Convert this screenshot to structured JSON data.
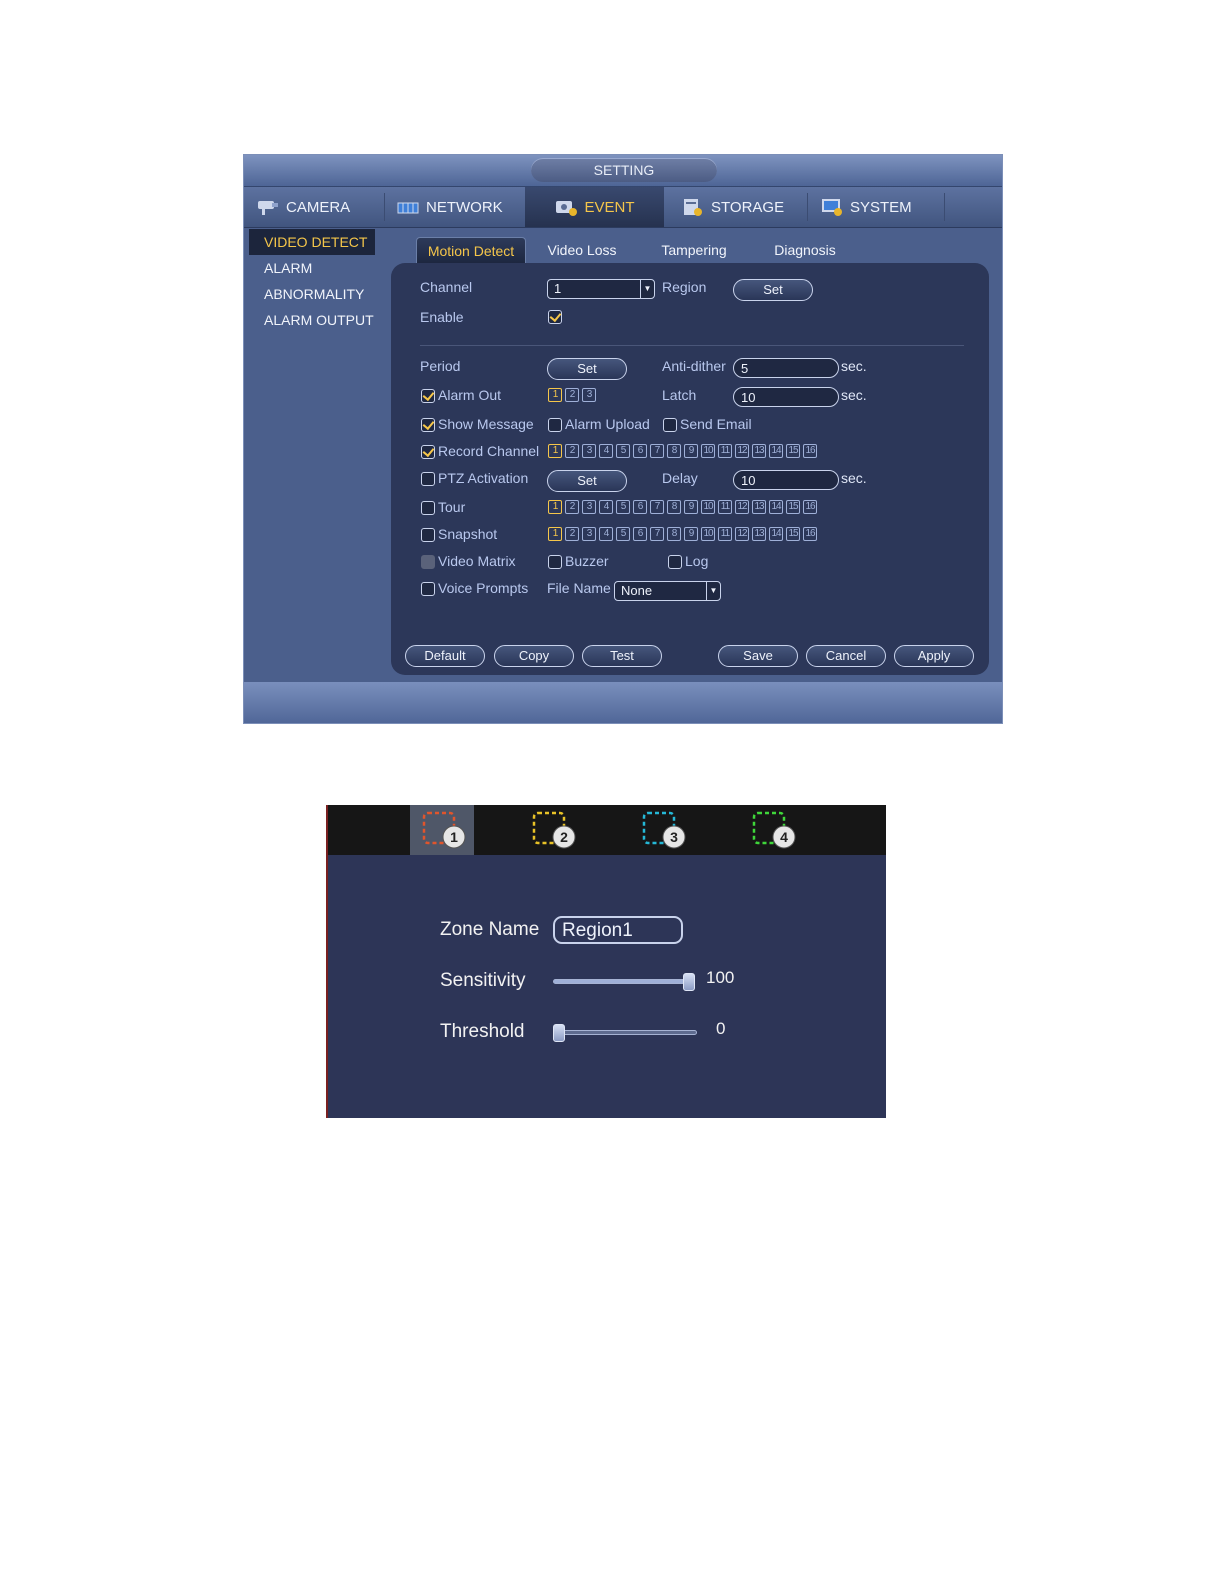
{
  "window": {
    "title": "SETTING"
  },
  "main_tabs": [
    {
      "label": "CAMERA",
      "icon": "camera-icon",
      "active": false
    },
    {
      "label": "NETWORK",
      "icon": "network-icon",
      "active": false
    },
    {
      "label": "EVENT",
      "icon": "event-icon",
      "active": true
    },
    {
      "label": "STORAGE",
      "icon": "storage-icon",
      "active": false
    },
    {
      "label": "SYSTEM",
      "icon": "system-icon",
      "active": false
    }
  ],
  "sidebar": {
    "items": [
      {
        "label": "VIDEO DETECT",
        "active": true
      },
      {
        "label": "ALARM",
        "active": false
      },
      {
        "label": "ABNORMALITY",
        "active": false
      },
      {
        "label": "ALARM OUTPUT",
        "active": false
      }
    ]
  },
  "sub_tabs": [
    {
      "label": "Motion Detect",
      "active": true
    },
    {
      "label": "Video Loss",
      "active": false
    },
    {
      "label": "Tampering",
      "active": false
    },
    {
      "label": "Diagnosis",
      "active": false
    }
  ],
  "form": {
    "channel_label": "Channel",
    "channel_value": "1",
    "region_label": "Region",
    "region_button": "Set",
    "enable_label": "Enable",
    "enable_checked": true,
    "period_label": "Period",
    "period_button": "Set",
    "antidither_label": "Anti-dither",
    "antidither_value": "5",
    "antidither_unit": "sec.",
    "alarm_out_label": "Alarm Out",
    "alarm_out_checked": true,
    "alarm_out_channels": [
      "1",
      "2",
      "3"
    ],
    "alarm_out_selected": [
      0
    ],
    "latch_label": "Latch",
    "latch_value": "10",
    "latch_unit": "sec.",
    "show_message_label": "Show Message",
    "show_message_checked": true,
    "alarm_upload_label": "Alarm Upload",
    "alarm_upload_checked": false,
    "send_email_label": "Send Email",
    "send_email_checked": false,
    "record_channel_label": "Record Channel",
    "record_channel_checked": true,
    "ptz_label": "PTZ Activation",
    "ptz_checked": false,
    "ptz_button": "Set",
    "delay_label": "Delay",
    "delay_value": "10",
    "delay_unit": "sec.",
    "tour_label": "Tour",
    "tour_checked": false,
    "snapshot_label": "Snapshot",
    "snapshot_checked": false,
    "video_matrix_label": "Video Matrix",
    "video_matrix_checked": false,
    "buzzer_label": "Buzzer",
    "buzzer_checked": false,
    "log_label": "Log",
    "log_checked": false,
    "voice_label": "Voice Prompts",
    "voice_checked": false,
    "file_name_label": "File Name",
    "file_name_value": "None",
    "channels16": [
      "1",
      "2",
      "3",
      "4",
      "5",
      "6",
      "7",
      "8",
      "9",
      "10",
      "11",
      "12",
      "13",
      "14",
      "15",
      "16"
    ],
    "record_selected": [
      0
    ],
    "tour_selected": [
      0
    ],
    "snapshot_selected": [
      0
    ]
  },
  "buttons": {
    "default": "Default",
    "copy": "Copy",
    "test": "Test",
    "save": "Save",
    "cancel": "Cancel",
    "apply": "Apply"
  },
  "region_panel": {
    "zones": [
      {
        "number": "1",
        "color": "#e0552c",
        "active": true
      },
      {
        "number": "2",
        "color": "#e8c227",
        "active": false
      },
      {
        "number": "3",
        "color": "#25b8d6",
        "active": false
      },
      {
        "number": "4",
        "color": "#3fd63a",
        "active": false
      }
    ],
    "zone_name_label": "Zone Name",
    "zone_name_value": "Region1",
    "sensitivity_label": "Sensitivity",
    "sensitivity_value": "100",
    "sensitivity_fraction": 1.0,
    "threshold_label": "Threshold",
    "threshold_value": "0",
    "threshold_fraction": 0.0
  },
  "colors": {
    "accent": "#f5c64a",
    "panel_bg": "#2c3759",
    "window_bg": "#4b5f8c"
  }
}
